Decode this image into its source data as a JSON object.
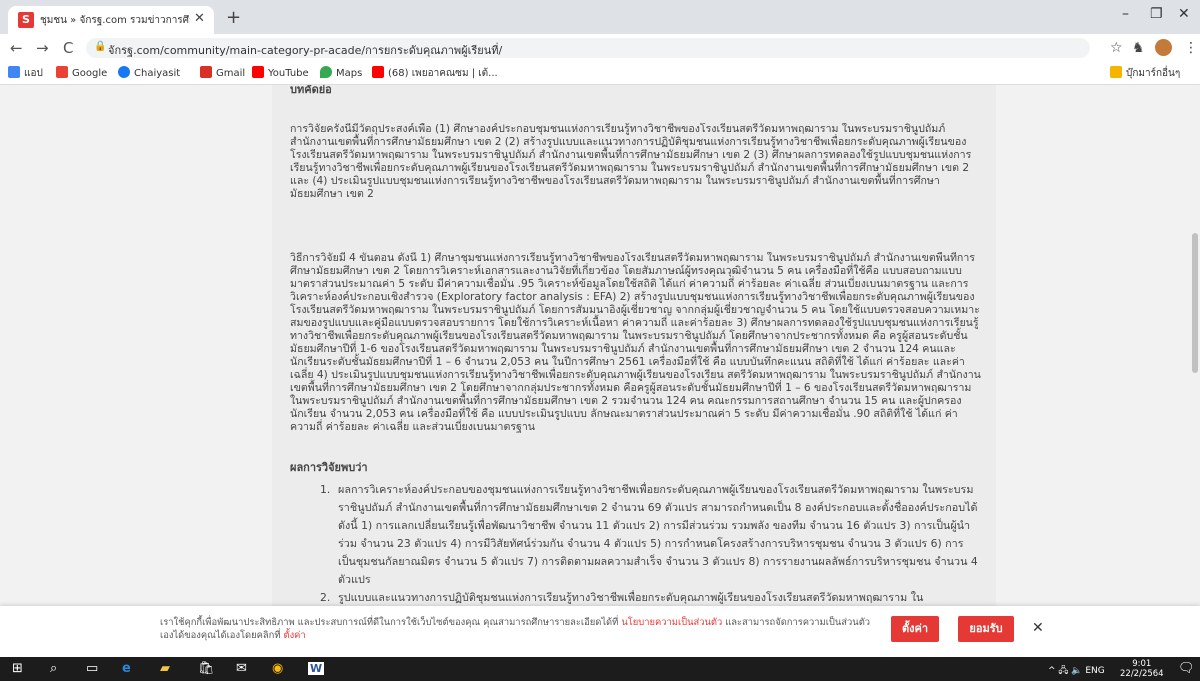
{
  "browser": {
    "tab": {
      "favicon_letter": "S",
      "title": "ชุมชน » จักรฐ.com รวมข่าวการศึกษ",
      "close": "✕"
    },
    "new_tab": "+",
    "window": {
      "minimize": "–",
      "restore": "❐",
      "close": "✕"
    },
    "nav": {
      "back": "←",
      "forward": "→",
      "reload": "C"
    },
    "url": "จักรฐ.com/community/main-category-pr-acade/การยกระดับคุณภาพผู้เรียนที่/",
    "lock": "🔒",
    "star": "☆",
    "menu": "⋮",
    "bookmarks": [
      {
        "label": "แอป",
        "color": "#4285f4"
      },
      {
        "label": "Google",
        "color": "#ea4335"
      },
      {
        "label": "Chaiyasit",
        "color": "#1877f2"
      },
      {
        "label": "Gmail",
        "color": "#d93025"
      },
      {
        "label": "YouTube",
        "color": "#ff0000"
      },
      {
        "label": "Maps",
        "color": "#34a853"
      },
      {
        "label": "(68) เพยอาคณซม | เต้...",
        "color": "#ff0000"
      }
    ],
    "other_bookmarks": "บุ๊กมาร์กอื่นๆ"
  },
  "article": {
    "heading": "บทคัดย่อ",
    "paragraph1": "การวิจัยครั้งนี้มีวัตถุประสงค์เพื่อ (1) ศึกษาองค์ประกอบชุมชนแห่งการเรียนรู้ทางวิชาชีพของโรงเรียนสตรีวัดมหาพฤฒาราม ในพระบรมราชินูปถัมภ์ สำนักงานเขตพื้นที่การศึกษามัธยมศึกษา เขต 2 (2) สร้างรูปแบบและแนวทางการปฏิบัติชุมชนแห่งการเรียนรู้ทางวิชาชีพเพื่อยกระดับคุณภาพผู้เรียนของโรงเรียนสตรีวัดมหาพฤฒาราม ในพระบรมราชินูปถัมภ์ สำนักงานเขตพื้นที่การศึกษามัธยมศึกษา เขต 2 (3) ศึกษาผลการทดลองใช้รูปแบบชุมชนแห่งการเรียนรู้ทางวิชาชีพเพื่อยกระดับคุณภาพผู้เรียนของโรงเรียนสตรีวัดมหาพฤฒาราม ในพระบรมราชินูปถัมภ์ สำนักงานเขตพื้นที่การศึกษามัธยมศึกษา เขต 2 และ (4) ประเมินรูปแบบชุมชนแห่งการเรียนรู้ทางวิชาชีพของโรงเรียนสตรีวัดมหาพฤฒาราม ในพระบรมราชินูปถัมภ์ สำนักงานเขตพื้นที่การศึกษามัธยมศึกษา เขต 2",
    "paragraph2": "วิธีการวิจัยมี 4 ขั้นตอน ดังนี้ 1) ศึกษาชุมชนแห่งการเรียนรู้ทางวิชาชีพของโรงเรียนสตรีวัดมหาพฤฒาราม ในพระบรมราชินูปถัมภ์ สำนักงานเขตพื้นที่การศึกษามัธยมศึกษา เขต 2 โดยการวิเคราะห์เอกสารและงานวิจัยที่เกี่ยวข้อง โดยสัมภาษณ์ผู้ทรงคุณวุฒิจำนวน 5 คน เครื่องมือที่ใช้คือ แบบสอบถามแบบมาตราส่วนประมาณค่า 5 ระดับ มีค่าความเชื่อมั่น .95 วิเคราะห์ข้อมูลโดยใช้สถิติ ได้แก่ ค่าความถี่ ค่าร้อยละ ค่าเฉลี่ย ส่วนเบี่ยงเบนมาตรฐาน และการวิเคราะห์องค์ประกอบเชิงสำรวจ (Exploratory factor analysis : EFA) 2) สร้างรูปแบบชุมชนแห่งการเรียนรู้ทางวิชาชีพเพื่อยกระดับคุณภาพผู้เรียนของโรงเรียนสตรีวัดมหาพฤฒาราม ในพระบรมราชินูปถัมภ์ โดยการสัมมนาอิงผู้เชี่ยวชาญ จากกลุ่มผู้เชี่ยวชาญจำนวน 5 คน โดยใช้แบบตรวจสอบความเหมาะสมของรูปแบบและคู่มือแบบตรวจสอบรายการ โดยใช้การวิเคราะห์เนื้อหา ค่าความถี่ และค่าร้อยละ 3) ศึกษาผลการทดลองใช้รูปแบบชุมชนแห่งการเรียนรู้ทางวิชาชีพเพื่อยกระดับคุณภาพผู้เรียนของโรงเรียนสตรีวัดมหาพฤฒาราม ในพระบรมราชินูปถัมภ์ โดยศึกษาจากประชากรทั้งหมด คือ ครูผู้สอนระดับชั้นมัธยมศึกษาปีที่ 1-6 ของโรงเรียนสตรีวัดมหาพฤฒาราม ในพระบรมราชินูปถัมภ์ สำนักงานเขตพื้นที่การศึกษามัธยมศึกษา เขต 2 จำนวน 124 คนและนักเรียนระดับชั้นมัธยมศึกษาปีที่ 1 – 6 จำนวน 2,053 คน ในปีการศึกษา 2561 เครื่องมือที่ใช้ คือ แบบบันทึกคะแนน สถิติที่ใช้ ได้แก่ ค่าร้อยละ และค่าเฉลี่ย 4) ประเมินรูปแบบชุมชนแห่งการเรียนรู้ทางวิชาชีพเพื่อยกระดับคุณภาพผู้เรียนของโรงเรียน สตรีวัดมหาพฤฒาราม ในพระบรมราชินูปถัมภ์ สำนักงานเขตพื้นที่การศึกษามัธยมศึกษา เขต 2 โดยศึกษาจากกลุ่มประชากรทั้งหมด คือครูผู้สอนระดับชั้นมัธยมศึกษาปีที่ 1 – 6 ของโรงเรียนสตรีวัดมหาพฤฒาราม ในพระบรมราชินูปถัมภ์ สำนักงานเขตพื้นที่การศึกษามัธยมศึกษา เขต 2 รวมจำนวน 124 คน คณะกรรมการสถานศึกษา จำนวน 15 คน และผู้ปกครองนักเรียน จำนวน 2,053 คน เครื่องมือที่ใช้ คือ แบบประเมินรูปแบบ ลักษณะมาตราส่วนประมาณค่า 5 ระดับ มีค่าความเชื่อมั่น .90 สถิติที่ใช้ ได้แก่ ค่าความถี่ ค่าร้อยละ ค่าเฉลี่ย และส่วนเบี่ยงเบนมาตรฐาน",
    "results_heading": "ผลการวิจัยพบว่า",
    "results": [
      {
        "num": "1.",
        "text": "ผลการวิเคราะห์องค์ประกอบของชุมชนแห่งการเรียนรู้ทางวิชาชีพเพื่อยกระดับคุณภาพผู้เรียนของโรงเรียนสตรีวัดมหาพฤฒาราม ในพระบรมราชินูปถัมภ์ สำนักงานเขตพื้นที่การศึกษามัธยมศึกษาเขต 2 จำนวน 69 ตัวแปร สามารถกำหนดเป็น 8 องค์ประกอบและตั้งชื่อองค์ประกอบได้ดังนี้ 1) การแลกเปลี่ยนเรียนรู้เพื่อพัฒนาวิชาชีพ จำนวน 11 ตัวแปร 2) การมีส่วนร่วม รวมพลัง ของทีม จำนวน 16 ตัวแปร 3) การเป็นผู้นำร่วม จำนวน 23 ตัวแปร 4) การมีวิสัยทัศน์ร่วมกัน จำนวน 4 ตัวแปร 5) การกำหนดโครงสร้างการบริหารชุมชน จำนวน 3 ตัวแปร 6) การเป็นชุมชนกัลยาณมิตร จำนวน 5 ตัวแปร 7) การติดตามผลความสำเร็จ จำนวน 3 ตัวแปร 8) การรายงานผลลัพธ์การบริหารชุมชน จำนวน 4 ตัวแปร"
      },
      {
        "num": "2.",
        "text": "รูปแบบและแนวทางการปฏิบัติชุมชนแห่งการเรียนรู้ทางวิชาชีพเพื่อยกระดับคุณภาพผู้เรียนของโรงเรียนสตรีวัดมหาพฤฒาราม ใน"
      }
    ]
  },
  "cookie": {
    "message_part1": "เราใช้คุกกี้เพื่อพัฒนาประสิทธิภาพ และประสบการณ์ที่ดีในการใช้เว็บไซต์ของคุณ คุณสามารถศึกษารายละเอียดได้ที่ ",
    "policy_link": "นโยบายความเป็นส่วนตัว",
    "message_part2": " และสามารถจัดการความเป็นส่วนตัวเองได้ของคุณได้เองโดยคลิกที่ ",
    "settings_link": "ตั้งค่า",
    "settings_button": "ตั้งค่า",
    "accept_button": "ยอมรับ",
    "close": "✕"
  },
  "taskbar": {
    "start": "⊞",
    "search": "⌕",
    "taskview": "▭",
    "apps": [
      "e",
      "▰",
      "🛍",
      "✉",
      "◉",
      "W"
    ],
    "tray": "^ 🖧 🔈 ENG",
    "time": "9:01",
    "date": "22/2/2564",
    "notify": "🗨"
  },
  "colors": {
    "accent": "#e53935",
    "page_bg": "#f2f2f2",
    "article_bg": "#ececec"
  }
}
